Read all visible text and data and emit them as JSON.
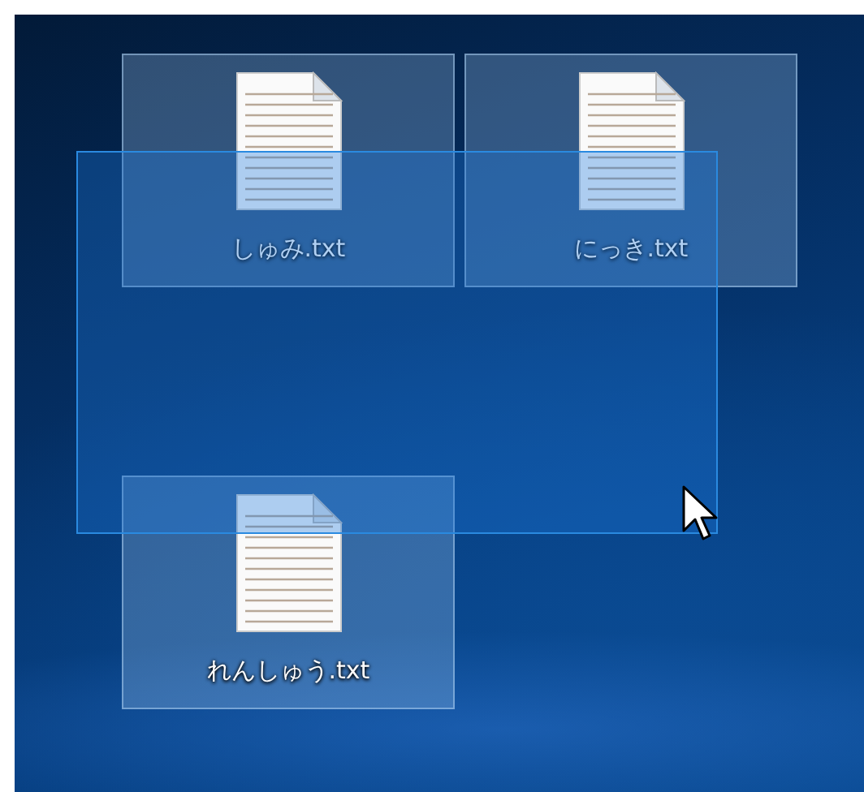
{
  "desktop": {
    "icons": [
      {
        "name": "しゅみ.txt",
        "selected": true
      },
      {
        "name": "にっき.txt",
        "selected": true
      },
      {
        "name": "れんしゅう.txt",
        "selected": true
      }
    ],
    "selection_rectangle": {
      "visible": true
    },
    "cursor": {
      "visible": true
    }
  }
}
